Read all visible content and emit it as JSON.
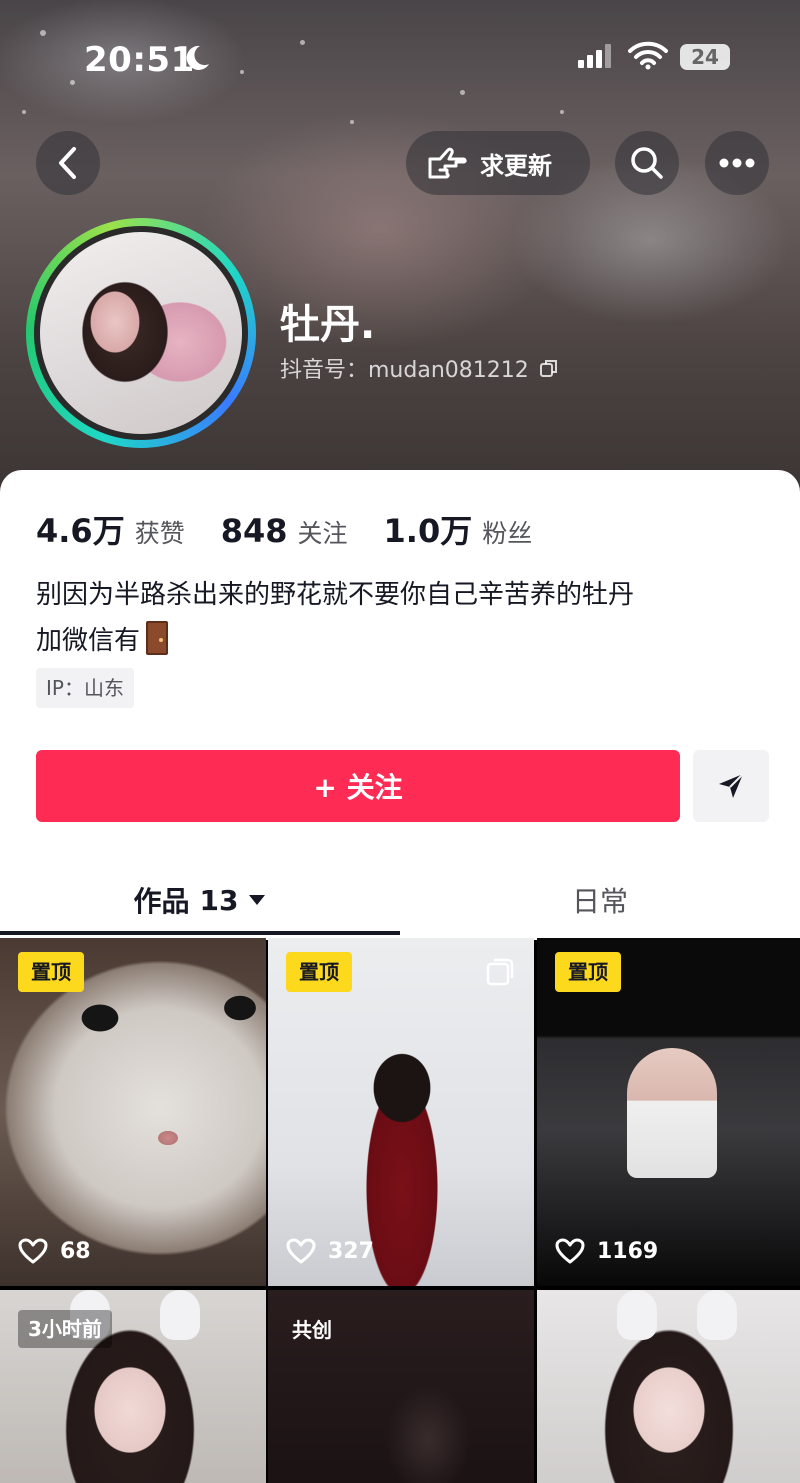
{
  "status_bar": {
    "time": "20:51",
    "battery": "24"
  },
  "header": {
    "update_button": "求更新",
    "icons": [
      "back-icon",
      "hand-point-icon",
      "search-icon",
      "more-icon",
      "moon-icon",
      "signal-icon",
      "wifi-icon",
      "copy-icon"
    ]
  },
  "profile": {
    "nickname": "牡丹.",
    "douyin_id": "抖音号：mudan081212"
  },
  "stats": [
    {
      "value": "4.6万",
      "label": "获赞"
    },
    {
      "value": "848",
      "label": "关注"
    },
    {
      "value": "1.0万",
      "label": "粉丝"
    }
  ],
  "bio": {
    "line1": "别因为半路杀出来的野花就不要你自己辛苦养的牡丹",
    "line2": "加微信有"
  },
  "ip_location": "IP：山东",
  "actions": {
    "follow": "+ 关注"
  },
  "tabs": {
    "works": "作品",
    "works_count": "13",
    "daily": "日常"
  },
  "videos": [
    {
      "badge": "置顶",
      "likes": "68"
    },
    {
      "badge": "置顶",
      "likes": "327"
    },
    {
      "badge": "置顶",
      "likes": "1169"
    },
    {
      "badge": "3小时前"
    },
    {
      "badge": "共创"
    },
    {
      "badge": ""
    }
  ],
  "colors": {
    "follow_button": "#fe2c55",
    "pin_badge": "#fdd91d",
    "text_primary": "#161823",
    "text_secondary": "#55565c"
  }
}
